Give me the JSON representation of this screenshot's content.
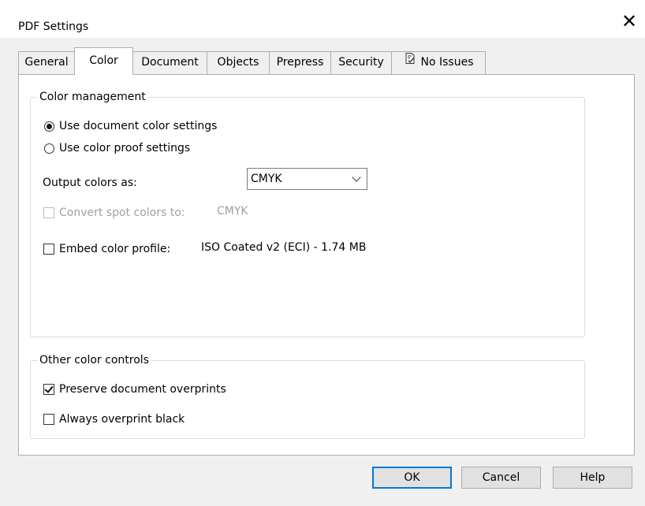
{
  "window": {
    "title": "PDF Settings",
    "close_glyph": "✕"
  },
  "tabs": [
    {
      "label": "General"
    },
    {
      "label": "Color",
      "active": true
    },
    {
      "label": "Document"
    },
    {
      "label": "Objects"
    },
    {
      "label": "Prepress"
    },
    {
      "label": "Security"
    },
    {
      "label": "No Issues",
      "icon": "checked-document-icon"
    }
  ],
  "color_management": {
    "title": "Color management",
    "radio_document": {
      "label": "Use document color settings",
      "selected": true
    },
    "radio_proof": {
      "label": "Use color proof settings",
      "selected": false
    },
    "output_colors": {
      "label": "Output colors as:",
      "value": "CMYK"
    },
    "convert_spot": {
      "label": "Convert spot colors to:",
      "value": "CMYK",
      "checked": false,
      "enabled": false
    },
    "embed_profile": {
      "label": "Embed color profile:",
      "value": "ISO Coated v2 (ECI) - 1.74 MB",
      "checked": false
    }
  },
  "other_controls": {
    "title": "Other color controls",
    "preserve_overprints": {
      "label": "Preserve document overprints",
      "checked": true
    },
    "overprint_black": {
      "label": "Always overprint black",
      "checked": false
    }
  },
  "buttons": {
    "ok": "OK",
    "cancel": "Cancel",
    "help": "Help"
  },
  "colors": {
    "accent": "#0078d7",
    "panel": "#ffffff",
    "chrome": "#f0f0f0",
    "disabled_text": "#a0a0a0"
  }
}
